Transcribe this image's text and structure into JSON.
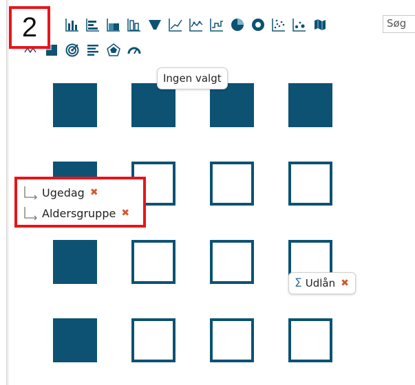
{
  "step_badge": "2",
  "toolbar": {
    "row1_icons": [
      "bar-chart-icon",
      "grouped-bar-icon",
      "horizontal-bar-icon",
      "stacked-bar-icon",
      "stacked-column-icon",
      "funnel-icon",
      "line-chart-icon",
      "area-line-icon",
      "step-line-icon",
      "pie-chart-icon",
      "donut-chart-icon",
      "scatter-plot-icon",
      "bubble-plot-icon",
      "map-icon"
    ],
    "row2_icons": [
      "sparkline-icon",
      "heatmap-icon",
      "target-icon",
      "list-icon",
      "radar-icon",
      "gauge-icon"
    ],
    "search_placeholder": "Søg"
  },
  "tooltip": "Ingen valgt",
  "dimensions": [
    {
      "label": "Ugedag",
      "remove": "✖"
    },
    {
      "label": "Aldersgruppe",
      "remove": "✖"
    }
  ],
  "measure": {
    "icon": "Σ",
    "label": "Udlån",
    "remove": "✖"
  },
  "colors": {
    "accent": "#0d5273",
    "highlight": "#e8141b",
    "remove": "#d05a2e"
  }
}
